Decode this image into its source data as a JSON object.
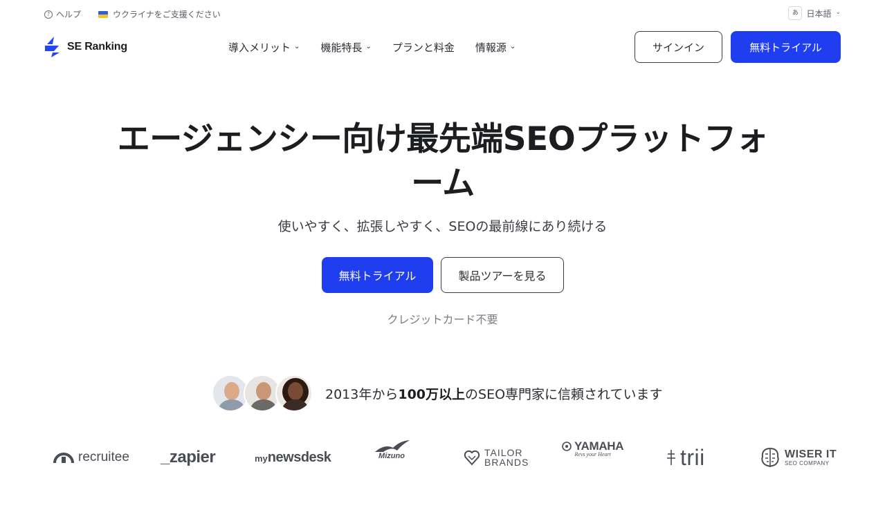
{
  "utility": {
    "help": "ヘルプ",
    "help_icon": "?",
    "ukraine": "ウクライナをご支援ください",
    "language_icon": "あ",
    "language": "日本語"
  },
  "brand": {
    "name": "SE Ranking"
  },
  "nav": {
    "items": [
      {
        "label": "導入メリット",
        "dropdown": true
      },
      {
        "label": "機能特長",
        "dropdown": true
      },
      {
        "label": "プランと料金",
        "dropdown": false
      },
      {
        "label": "情報源",
        "dropdown": true
      }
    ],
    "signin": "サインイン",
    "trial": "無料トライアル"
  },
  "hero": {
    "title": "エージェンシー向け最先端SEOプラットフォーム",
    "subtitle": "使いやすく、拡張しやすく、SEOの最前線にあり続ける",
    "primary_cta": "無料トライアル",
    "secondary_cta": "製品ツアーを見る",
    "note": "クレジットカード不要"
  },
  "trust": {
    "prefix": "2013年から",
    "highlight": "100万以上",
    "suffix": "のSEO専門家に信頼されています"
  },
  "logos": {
    "recruitee": "recruitee",
    "zapier": "_zapier",
    "mynewsdesk_my": "my",
    "mynewsdesk_main": "newsdesk",
    "mizuno": "Mizuno",
    "tailor_1": "TAILOR",
    "tailor_2": "BRANDS",
    "yamaha": "YAMAHA",
    "yamaha_tag": "Revs your Heart",
    "trii": "trii",
    "wiser_1": "WISER IT",
    "wiser_2": "SEO COMPANY"
  },
  "colors": {
    "accent": "#1f3ef0",
    "text": "#1c1d21",
    "muted": "#7a7d86"
  }
}
